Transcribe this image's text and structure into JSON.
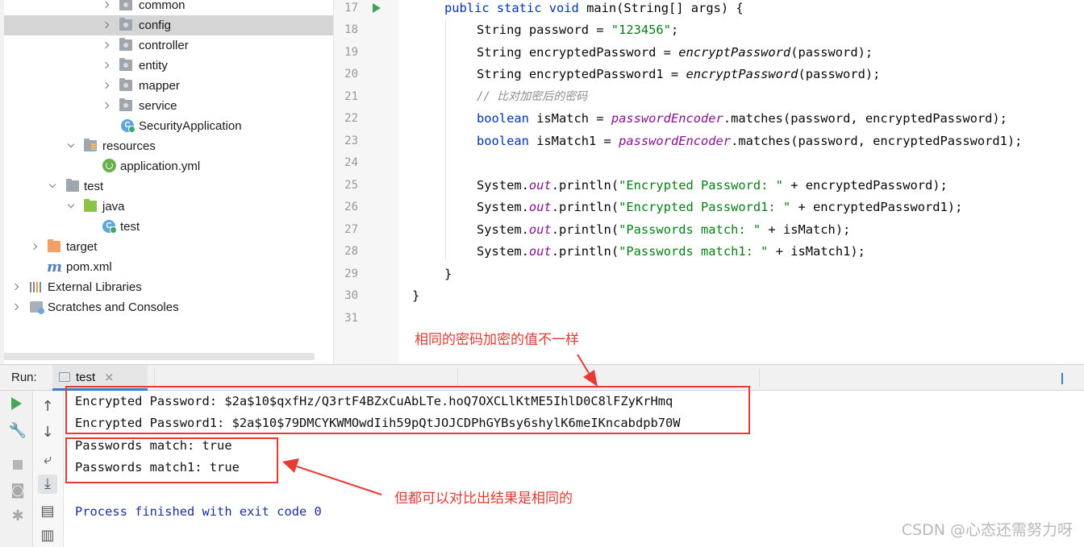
{
  "tree": {
    "items": [
      {
        "label": "common",
        "icon": "package-folder-icon"
      },
      {
        "label": "config",
        "icon": "package-folder-icon",
        "selected": true
      },
      {
        "label": "controller",
        "icon": "package-folder-icon"
      },
      {
        "label": "entity",
        "icon": "package-folder-icon"
      },
      {
        "label": "mapper",
        "icon": "package-folder-icon"
      },
      {
        "label": "service",
        "icon": "package-folder-icon"
      },
      {
        "label": "SecurityApplication",
        "icon": "spring-class-icon"
      },
      {
        "label": "resources",
        "icon": "resources-folder-icon"
      },
      {
        "label": "application.yml",
        "icon": "spring-config-icon"
      },
      {
        "label": "test",
        "icon": "folder-icon"
      },
      {
        "label": "java",
        "icon": "test-source-folder-icon"
      },
      {
        "label": "test",
        "icon": "class-icon"
      },
      {
        "label": "target",
        "icon": "excluded-folder-icon"
      },
      {
        "label": "pom.xml",
        "icon": "maven-icon"
      },
      {
        "label": "External Libraries",
        "icon": "libraries-icon"
      },
      {
        "label": "Scratches and Consoles",
        "icon": "scratches-icon"
      }
    ]
  },
  "editor": {
    "line_numbers": [
      "17",
      "18",
      "19",
      "20",
      "21",
      "22",
      "23",
      "24",
      "25",
      "26",
      "27",
      "28",
      "29",
      "30",
      "31"
    ],
    "lines": {
      "l17": {
        "kw": "public static void",
        "rest": " main(String[] args) {"
      },
      "l18": {
        "a": "String password = ",
        "s": "\"123456\"",
        "b": ";"
      },
      "l19": {
        "a": "String encryptedPassword = ",
        "m": "encryptPassword",
        "b": "(password);"
      },
      "l20": {
        "a": "String encryptedPassword1 = ",
        "m": "encryptPassword",
        "b": "(password);"
      },
      "l21": {
        "c": "// 比对加密后的密码"
      },
      "l22": {
        "kw": "boolean",
        "a": " isMatch = ",
        "f": "passwordEncoder",
        "b": ".matches(password, encryptedPassword);"
      },
      "l23": {
        "kw": "boolean",
        "a": " isMatch1 = ",
        "f": "passwordEncoder",
        "b": ".matches(password, encryptedPassword1);"
      },
      "l25": {
        "a": "System.",
        "o": "out",
        "p": ".println(",
        "s": "\"Encrypted Password: \"",
        "b": " + encryptedPassword);"
      },
      "l26": {
        "a": "System.",
        "o": "out",
        "p": ".println(",
        "s": "\"Encrypted Password1: \"",
        "b": " + encryptedPassword1);"
      },
      "l27": {
        "a": "System.",
        "o": "out",
        "p": ".println(",
        "s": "\"Passwords match: \"",
        "b": " + isMatch);"
      },
      "l28": {
        "a": "System.",
        "o": "out",
        "p": ".println(",
        "s": "\"Passwords match1: \"",
        "b": " + isMatch1);"
      },
      "l29": {
        "a": "}"
      },
      "l30": {
        "a": "}"
      }
    }
  },
  "run": {
    "label": "Run:",
    "tab_label": "test",
    "tab_close": "×",
    "output": [
      "Encrypted Password: $2a$10$qxfHz/Q3rtF4BZxCuAbLTe.hoQ7OXCLlKtME5IhlD0C8lFZyKrHmq",
      "Encrypted Password1: $2a$10$79DMCYKWMOwdIih59pQtJOJCDPhGYBsy6shylK6meIKncabdpb70W",
      "Passwords match: true",
      "Passwords match1: true",
      "Process finished with exit code 0"
    ]
  },
  "annotations": {
    "top": "相同的密码加密的值不一样",
    "bottom": "但都可以对比出结果是相同的"
  },
  "watermark": "CSDN @心态还需努力呀",
  "colors": {
    "annotation": "#e53b35",
    "keyword": "#0033b3",
    "string": "#067d17",
    "field": "#871094",
    "exit_text": "#1d2f9e"
  }
}
